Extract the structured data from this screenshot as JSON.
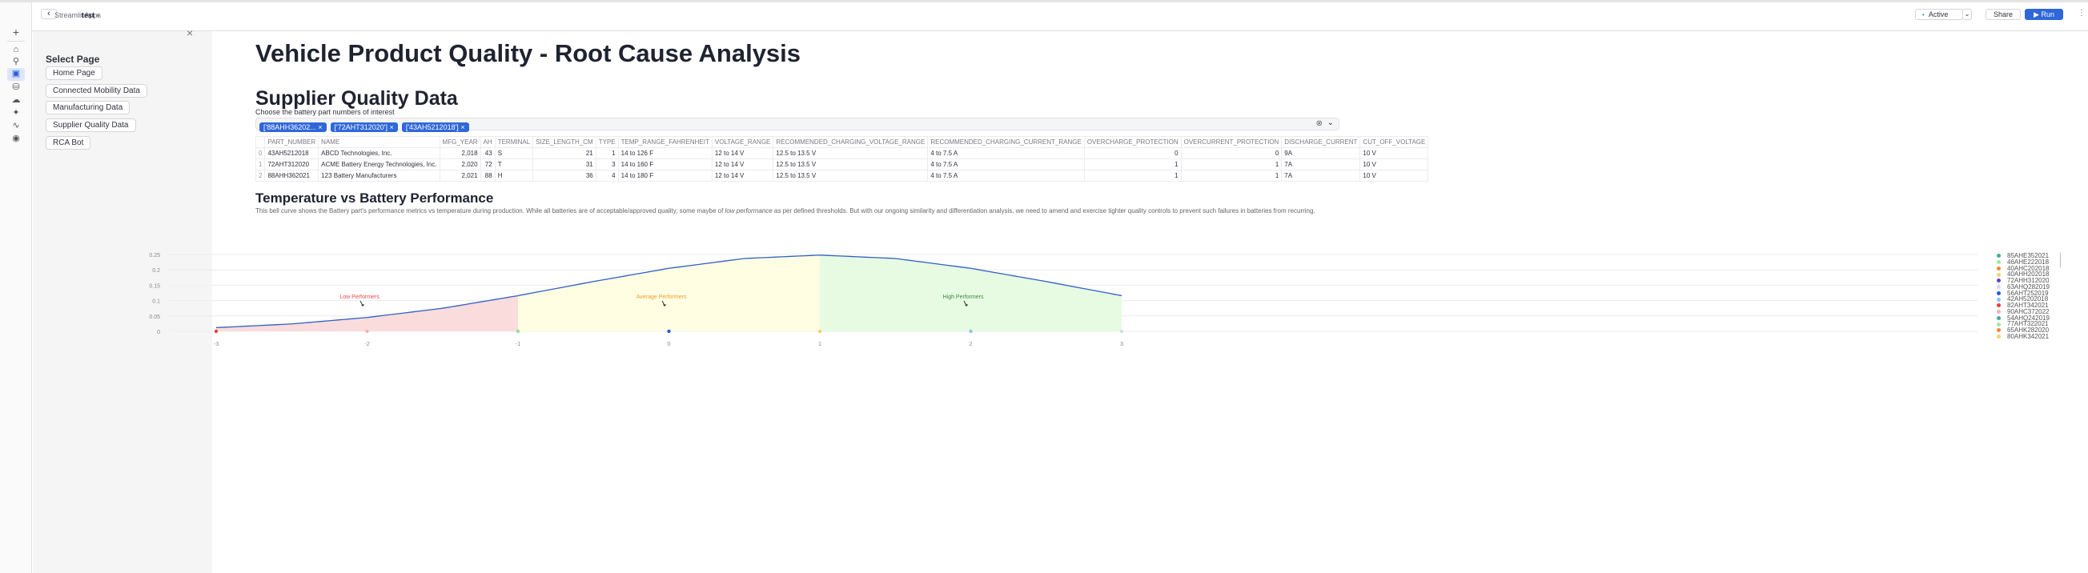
{
  "header": {
    "back_label": "‹",
    "breadcrumb_app": "Streamlit Apps",
    "breadcrumb_name": "test",
    "status": "Active",
    "share": "Share",
    "run": "Run",
    "status_color": "#2e9e6b",
    "accent": "#2f67d9"
  },
  "rail": {
    "items": [
      "plus",
      "home",
      "search",
      "streamlit",
      "database",
      "cloud",
      "sparkle",
      "activity",
      "shield"
    ]
  },
  "sidebar": {
    "close": "×",
    "title": "Select Page",
    "buttons": [
      "Home Page",
      "Connected Mobility Data",
      "Manufacturing Data",
      "Supplier Quality Data",
      "RCA Bot"
    ]
  },
  "main": {
    "title": "Vehicle Product Quality - Root Cause Analysis",
    "section_title": "Supplier Quality Data",
    "select_label": "Choose the battery part numbers of interest",
    "selected": [
      "['88AHH36202...",
      "['72AHT312020']",
      "['43AH5212018']"
    ],
    "table": {
      "columns": [
        "",
        "PART_NUMBER",
        "NAME",
        "MFG_YEAR",
        "AH",
        "TERMINAL",
        "SIZE_LENGTH_CM",
        "TYPE",
        "TEMP_RANGE_FAHRENHEIT",
        "VOLTAGE_RANGE",
        "RECOMMENDED_CHARGING_VOLTAGE_RANGE",
        "RECOMMENDED_CHARGING_CURRENT_RANGE",
        "OVERCHARGE_PROTECTION",
        "OVERCURRENT_PROTECTION",
        "DISCHARGE_CURRENT",
        "CUT_OFF_VOLTAGE"
      ],
      "rows": [
        [
          "0",
          "43AH5212018",
          "ABCD Technologies, Inc.",
          "2,018",
          "43",
          "S",
          "21",
          "1",
          "14 to 126 F",
          "12 to 14 V",
          "12.5 to 13.5 V",
          "4 to 7.5 A",
          "0",
          "0",
          "9A",
          "10 V"
        ],
        [
          "1",
          "72AHT312020",
          "ACME Battery Energy Technologies, Inc.",
          "2,020",
          "72",
          "T",
          "31",
          "3",
          "14 to 160 F",
          "12 to 14 V",
          "12.5 to 13.5 V",
          "4 to 7.5 A",
          "1",
          "1",
          "7A",
          "10 V"
        ],
        [
          "2",
          "88AHH362021",
          "123 Battery Manufacturers",
          "2,021",
          "88",
          "H",
          "36",
          "4",
          "14 to 180 F",
          "12 to 14 V",
          "12.5 to 13.5 V",
          "4 to 7.5 A",
          "1",
          "1",
          "7A",
          "10 V"
        ]
      ]
    },
    "chart_title": "Temperature vs Battery Performance",
    "chart_desc_1": "This bell curve shows the Battery part's performance metrics vs temperature during production. While all batteries are of acceptable/approved quality, some maybe of ",
    "chart_desc_em": "low performance",
    "chart_desc_2": " as per defined thresholds. But with our ongoing similarity and differentiation analysis, we need to amend and exercise tighter quality controls to prevent such failures in batteries from recurring."
  },
  "chart_data": {
    "type": "area",
    "x": [
      -3,
      -2.5,
      -2,
      -1.5,
      -1,
      -0.5,
      0,
      0.5,
      1,
      1.5,
      2,
      2.5,
      3
    ],
    "y": [
      0.012,
      0.024,
      0.045,
      0.075,
      0.116,
      0.162,
      0.205,
      0.237,
      0.248,
      0.237,
      0.205,
      0.162,
      0.116
    ],
    "xticks": [
      "-3",
      "-2",
      "-1",
      "0",
      "1",
      "2",
      "3"
    ],
    "yticks": [
      "0",
      "0.05",
      "0.1",
      "0.15",
      "0.2",
      "0.25"
    ],
    "xlim": [
      -3,
      3
    ],
    "ylim": [
      0,
      0.25
    ],
    "grid": true,
    "line_color": "#2f5fc4",
    "regions": [
      {
        "from": -3,
        "to": -1,
        "color": "#fadcdc",
        "label": "Low Performers",
        "label_color": "#f04848",
        "label_x": -2.05
      },
      {
        "from": -1,
        "to": 1,
        "color": "#fffde2",
        "label": "Average Performers",
        "label_color": "#f0a030",
        "label_x": -0.05
      },
      {
        "from": 1,
        "to": 3,
        "color": "#e6fbe2",
        "label": "High Performers",
        "label_color": "#3d8a3d",
        "label_x": 1.95
      }
    ],
    "points": [
      {
        "x": -3,
        "color": "#e8413a"
      },
      {
        "x": -2,
        "color": "#f3b3b3"
      },
      {
        "x": -1,
        "color": "#8ee08e"
      },
      {
        "x": 0,
        "color": "#2a5bd7"
      },
      {
        "x": 1,
        "color": "#f5d060"
      },
      {
        "x": 2,
        "color": "#8fc2f5"
      },
      {
        "x": 3,
        "color": "#d8d8e6"
      }
    ],
    "legend_position": "right",
    "legend": [
      {
        "name": "85AHE352021",
        "color": "#4aa89a"
      },
      {
        "name": "46AHE222018",
        "color": "#9de8a8"
      },
      {
        "name": "40AHC202018",
        "color": "#f08a3a"
      },
      {
        "name": "40AHH202018",
        "color": "#f8d070"
      },
      {
        "name": "72AHH312020",
        "color": "#6a3fc4"
      },
      {
        "name": "63AHQ282019",
        "color": "#d8dce8"
      },
      {
        "name": "56AHT252019",
        "color": "#2a5bd7"
      },
      {
        "name": "42AH5202018",
        "color": "#8fc2f5"
      },
      {
        "name": "82AHT342021",
        "color": "#e8413a"
      },
      {
        "name": "90AHC372022",
        "color": "#f3b3b3"
      },
      {
        "name": "54AHQ242019",
        "color": "#4aa89a"
      },
      {
        "name": "77AHT322021",
        "color": "#9de8a8"
      },
      {
        "name": "65AHK282020",
        "color": "#f08a3a"
      },
      {
        "name": "80AHK342021",
        "color": "#f8d070"
      }
    ]
  }
}
